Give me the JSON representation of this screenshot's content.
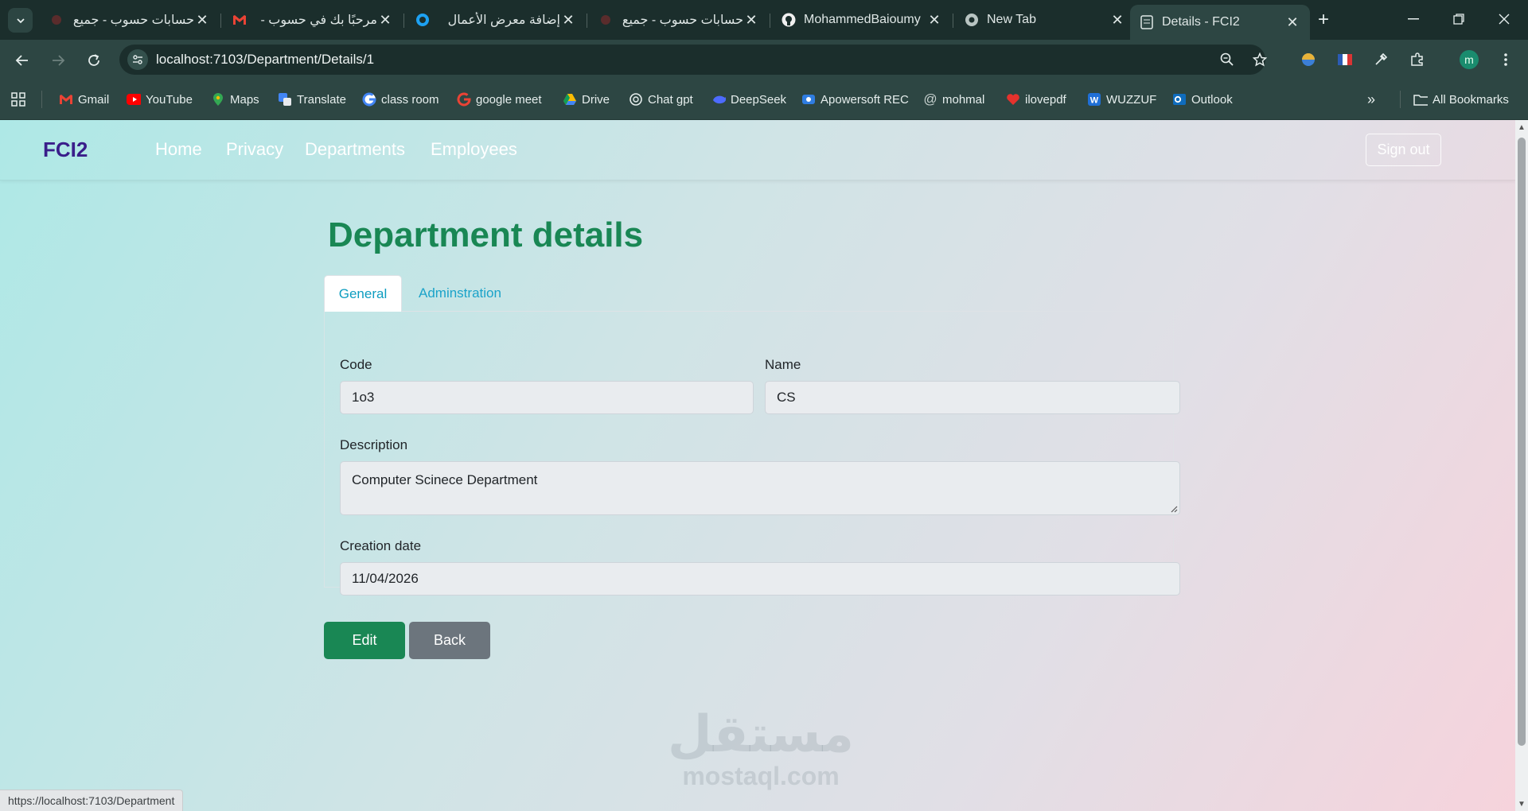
{
  "browser": {
    "tabs": [
      {
        "title": "حسابات حسوب - جميع",
        "icon": "loading-icon"
      },
      {
        "title": "مرحبًا بك في حسوب -",
        "icon": "gmail-icon"
      },
      {
        "title": "إضافة معرض الأعمال",
        "icon": "circle-icon"
      },
      {
        "title": "حسابات حسوب - جميع",
        "icon": "loading-icon"
      },
      {
        "title": "MohammedBaioumy",
        "icon": "github-icon"
      },
      {
        "title": "New Tab",
        "icon": "chrome-icon"
      },
      {
        "title": "Details - FCI2",
        "icon": "page-icon",
        "active": true
      }
    ],
    "url": "localhost:7103/Department/Details/1",
    "profile_initial": "m",
    "bookmarks": [
      {
        "label": "Gmail"
      },
      {
        "label": "YouTube"
      },
      {
        "label": "Maps"
      },
      {
        "label": "Translate"
      },
      {
        "label": "class room"
      },
      {
        "label": "google meet"
      },
      {
        "label": "Drive"
      },
      {
        "label": "Chat gpt"
      },
      {
        "label": "DeepSeek"
      },
      {
        "label": "Apowersoft REC"
      },
      {
        "label": "mohmal"
      },
      {
        "label": "ilovepdf"
      },
      {
        "label": "WUZZUF"
      },
      {
        "label": "Outlook"
      }
    ],
    "all_bookmarks_label": "All Bookmarks",
    "status_url": "https://localhost:7103/Department"
  },
  "navbar": {
    "brand": "FCI2",
    "links": [
      "Home",
      "Privacy",
      "Departments",
      "Employees"
    ],
    "signout": "Sign out"
  },
  "page": {
    "title": "Department details",
    "tabs": [
      "General",
      "Adminstration"
    ],
    "form": {
      "code_label": "Code",
      "code_value": "1o3",
      "name_label": "Name",
      "name_value": "CS",
      "description_label": "Description",
      "description_value": "Computer Scinece Department",
      "creation_label": "Creation date",
      "creation_value": "11/04/2026"
    },
    "buttons": {
      "edit": "Edit",
      "back": "Back"
    }
  },
  "watermark": {
    "arabic": "مستقل",
    "latin": "mostaql.com"
  },
  "colors": {
    "primary": "#198754",
    "secondary": "#6c757d",
    "brand": "#3a1e8a",
    "tab_link": "#1ba3c9"
  }
}
